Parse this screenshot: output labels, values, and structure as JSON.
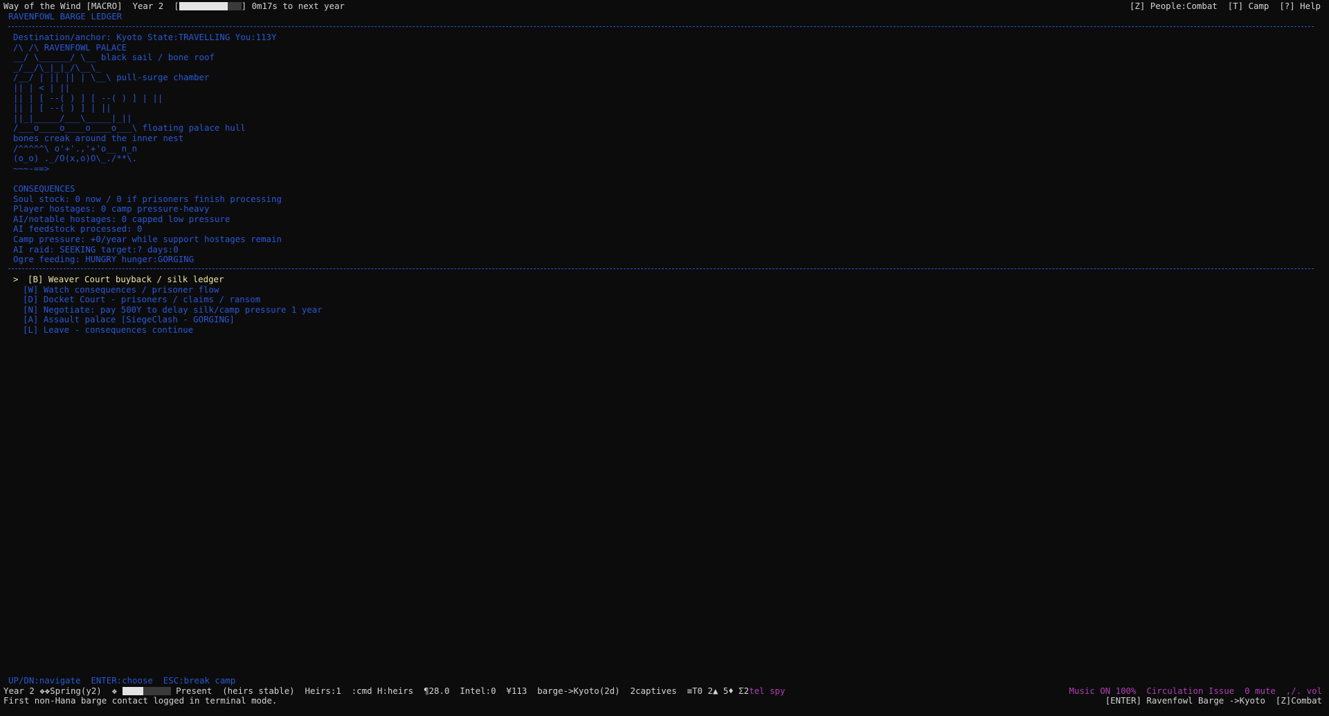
{
  "topbar": {
    "title": "Way of the Wind [MACRO]",
    "year": "Year 2",
    "bar_open": "[",
    "bar_close": "]",
    "year_progress": 0.78,
    "timer": "0m17s to next year",
    "shortcuts": [
      {
        "label": "[Z] People:Combat"
      },
      {
        "label": "[T] Camp"
      },
      {
        "label": "[?] Help"
      }
    ]
  },
  "panel": {
    "title": "RAVENFOWL BARGE LEDGER",
    "status_line": "Destination/anchor: Kyoto State:TRAVELLING You:113Y",
    "art_lines": [
      "/\\ /\\ RAVENFOWL PALACE",
      "__/ \\______/ \\__ black sail / bone roof",
      "_/__/\\_|_|_/\\__\\_",
      "/__/ | || || | \\__\\ pull-surge chamber",
      "|| | < | ||",
      "|| | [ --( ) ] [ --( ) ] | ||",
      "|| | [ --( ) ] | ||",
      "||_|_____/___\\_____|_||",
      "/___o____o____o____o___\\ floating palace hull",
      "bones creak around the inner nest",
      "/^^^^^\\ o'+'.,'+'o__ n_n",
      "(o_o) ._/O(x,o)O\\_./**\\.",
      "~~~-==>"
    ],
    "consequences_title": "CONSEQUENCES",
    "consequences": [
      "Soul stock: 0 now / 0 if prisoners finish processing",
      "Player hostages: 0 camp pressure-heavy",
      "AI/notable hostages: 0 capped low pressure",
      "AI feedstock processed: 0",
      "Camp pressure: +0/year while support hostages remain",
      "AI raid: SEEKING target:? days:0",
      "Ogre feeding: HUNGRY hunger:GORGING"
    ]
  },
  "menu": {
    "cursor": ">",
    "selected_index": 0,
    "options": [
      {
        "label": "[B] Weaver Court buyback / silk ledger"
      },
      {
        "label": "[W] Watch consequences / prisoner flow"
      },
      {
        "label": "[D] Docket Court - prisoners / claims / ransom"
      },
      {
        "label": "[N] Negotiate: pay 500Y to delay silk/camp pressure 1 year"
      },
      {
        "label": "[A] Assault palace [SiegeClash - GORGING]"
      },
      {
        "label": "[L] Leave - consequences continue"
      }
    ]
  },
  "footer": {
    "keys_hint": "UP/DN:navigate  ENTER:choose  ESC:break camp",
    "status_left": "Year 2 ❖❖Spring(y2)  ❖",
    "season_progress": 0.43,
    "status_mid": "Present  (heirs stable)  Heirs:1  :cmd H:heirs  ¶28.0  Intel:0  ¥113  barge->Kyoto(2d)  2captives  ≡T0 2▲ 5♦ Σ2",
    "status_tail": "tel spy",
    "status_right": "Music ON 100%  Circulation Issue  0 mute  ,/. vol",
    "message": "First non-Hana barge contact logged in terminal mode.",
    "hint_right": "[ENTER] Ravenfowl Barge ->Kyoto  [Z]Combat"
  },
  "colors": {
    "background": "#0c0c0c",
    "text": "#d4d4d4",
    "accent_blue": "#2a58d6",
    "selected": "#e9e3a6",
    "magenta": "#b13fb8"
  }
}
